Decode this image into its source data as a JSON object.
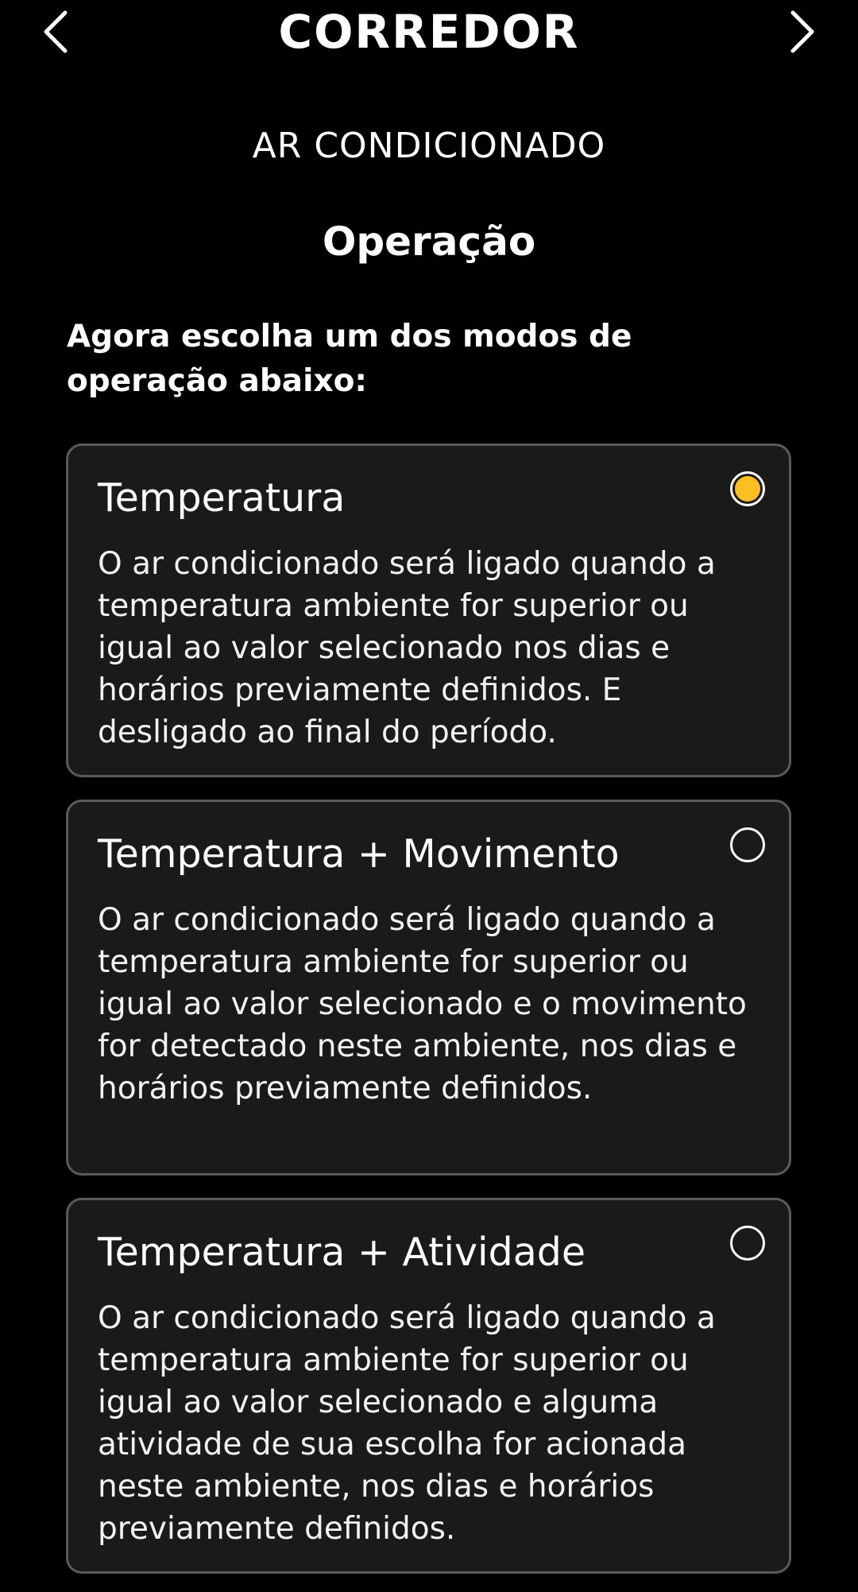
{
  "header": {
    "title": "CORREDOR",
    "prev_icon": "chevron-left-icon",
    "next_icon": "chevron-right-icon"
  },
  "device": {
    "title": "AR CONDICIONADO"
  },
  "section": {
    "title": "Operação",
    "instruction": "Agora escolha um dos modos de operação abaixo:"
  },
  "accent_color": "#fbbf24",
  "modes": [
    {
      "title": "Temperatura",
      "description": "O ar condicionado será ligado quando a temperatura ambiente for superior ou igual ao valor selecionado nos dias e horários previamente definidos. E desligado ao final do período.",
      "selected": true
    },
    {
      "title": "Temperatura + Movimento",
      "description": "O ar condicionado será ligado quando a temperatura ambiente for superior ou igual ao valor selecionado e o movimento for detectado neste ambiente, nos dias e horários previamente definidos.",
      "selected": false
    },
    {
      "title": "Temperatura + Atividade",
      "description": "O ar condicionado será ligado quando a temperatura ambiente for superior ou igual ao valor selecionado e alguma atividade de sua escolha for acionada neste ambiente, nos dias e horários previamente definidos.",
      "selected": false
    }
  ]
}
